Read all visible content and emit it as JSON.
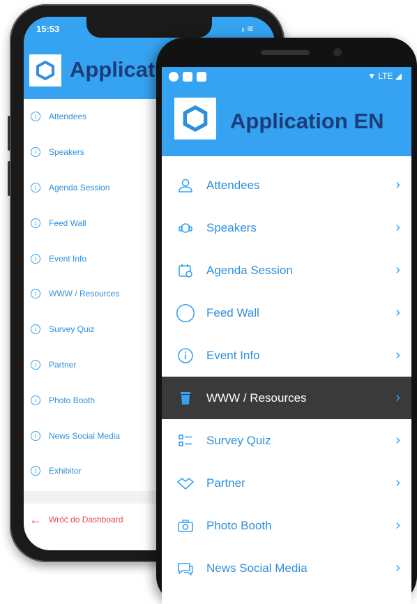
{
  "ios": {
    "status_time": "15:53",
    "status_right": "ᵢₗ ≋",
    "app_title": "Applicat",
    "menu": [
      {
        "label": "Attendees"
      },
      {
        "label": "Speakers"
      },
      {
        "label": "Agenda Session"
      },
      {
        "label": "Feed Wall"
      },
      {
        "label": "Event Info"
      },
      {
        "label": "WWW / Resources"
      },
      {
        "label": "Survey Quiz"
      },
      {
        "label": "Partner"
      },
      {
        "label": "Photo Booth"
      },
      {
        "label": "News Social Media"
      },
      {
        "label": "Exhibitor"
      }
    ],
    "back_label": "Wróć do Dashboard"
  },
  "android": {
    "status_right": "▼ LTE ◢",
    "app_title": "Application EN",
    "menu": [
      {
        "label": "Attendees",
        "icon": "person-icon"
      },
      {
        "label": "Speakers",
        "icon": "headset-icon"
      },
      {
        "label": "Agenda Session",
        "icon": "calendar-icon"
      },
      {
        "label": "Feed Wall",
        "icon": "circle-icon"
      },
      {
        "label": "Event Info",
        "icon": "info-icon"
      },
      {
        "label": "WWW / Resources",
        "icon": "trash-icon",
        "active": true
      },
      {
        "label": "Survey Quiz",
        "icon": "list-icon"
      },
      {
        "label": "Partner",
        "icon": "handshake-icon"
      },
      {
        "label": "Photo Booth",
        "icon": "camera-icon"
      },
      {
        "label": "News Social Media",
        "icon": "chat-icon"
      }
    ]
  },
  "colors": {
    "header_blue": "#35a3f1",
    "title_navy": "#1b3d7a",
    "link_blue": "#2f8fdc",
    "active_bg": "#3a3a3a",
    "back_red": "#e8455e"
  }
}
